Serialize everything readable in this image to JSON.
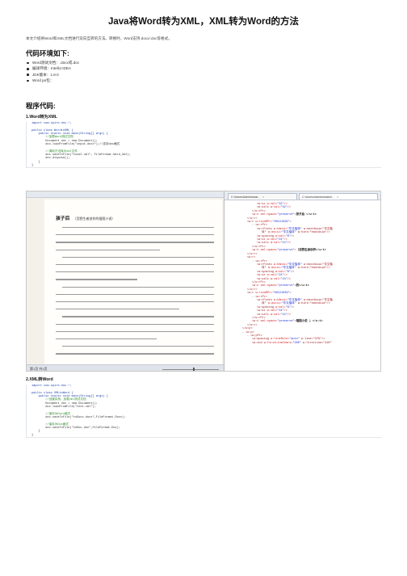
{
  "page": {
    "title": "Java将Word转为XML，XML转为Word的方法",
    "intro": "本文介绍将Word和XML文档进行双向互转的方法。转换时，Word支持.docx/.doc等格式。"
  },
  "env": {
    "heading": "代码环境如下:",
    "items": [
      "Word测试文档：.docx或.doc",
      "编译环境：IntelliJ IDEA",
      "JDK版本：1.8.0",
      "Word jar包："
    ]
  },
  "code_section": {
    "heading": "程序代码:",
    "sub1": "1.Word转为XML",
    "code1": [
      {
        "text": "import com.spire.doc.*;",
        "style": "kw"
      },
      {
        "text": "",
        "style": ""
      },
      {
        "text": "public class WordtoXML {",
        "style": "kw"
      },
      {
        "text": "    public static void main(String[] args) {",
        "style": "kw"
      },
      {
        "text": "        //加载Word测试文档",
        "style": "cm"
      },
      {
        "text": "        Document doc = new Document();",
        "style": ""
      },
      {
        "text": "        doc.loadFromFile(\"input.docx\");//支持doc格式",
        "style": ""
      },
      {
        "text": "",
        "style": ""
      },
      {
        "text": "        //调用方法转为xml文件",
        "style": "cm"
      },
      {
        "text": "        doc.saveToFile(\"toxml.xml\", FileFormat.Word_Xml);",
        "style": ""
      },
      {
        "text": "        doc.dispose();",
        "style": ""
      },
      {
        "text": "    }",
        "style": ""
      },
      {
        "text": "}",
        "style": ""
      }
    ],
    "sub2": "2.XML转Word",
    "code2": [
      {
        "text": "import com.spire.doc.*;",
        "style": "kw"
      },
      {
        "text": "",
        "style": ""
      },
      {
        "text": "public class XMLtoWord {",
        "style": "kw"
      },
      {
        "text": "    public static void main(String[] args) {",
        "style": "kw"
      },
      {
        "text": "        //创建实例，加载xml测试文档",
        "style": "cm"
      },
      {
        "text": "        Document doc = new Document();",
        "style": ""
      },
      {
        "text": "        doc.loadFromFile(\"test.xml\");",
        "style": ""
      },
      {
        "text": "",
        "style": ""
      },
      {
        "text": "        //保存为Docx格式",
        "style": "cm"
      },
      {
        "text": "        doc.saveToFile(\"toDocx.docx\",FileFormat.Docx);",
        "style": ""
      },
      {
        "text": "",
        "style": ""
      },
      {
        "text": "        //保存为Doc格式",
        "style": "cm"
      },
      {
        "text": "        doc.saveToFile(\"toDoc.doc\",FileFormat.Doc);",
        "style": ""
      },
      {
        "text": "    }",
        "style": ""
      },
      {
        "text": "}",
        "style": ""
      }
    ]
  },
  "screenshot": {
    "doc_heading": "孩子后",
    "doc_subheading": "（怎野生者创作的插图小说）",
    "status_page": "第1页 共1页",
    "tab1": "C:\\Users\\Administrat...",
    "tab2": "C:\\Users\\Administrator\\...",
    "xml_lines": [
      {
        "i": 6,
        "pre": "<w:sz ",
        "attr": "w:val=",
        "val": "\"32\"",
        "post": "/>",
        "text": ""
      },
      {
        "i": 6,
        "pre": "<w:szCs ",
        "attr": "w:val=",
        "val": "\"32\"",
        "post": "/>",
        "text": ""
      },
      {
        "i": 5,
        "pre": "</w:rPr>",
        "attr": "",
        "val": "",
        "post": "",
        "text": ""
      },
      {
        "i": 5,
        "pre": "<w:t ",
        "attr": "xml:space=",
        "val": "\"preserve\"",
        "post": ">",
        "text": "孩子后 </w:t>"
      },
      {
        "i": 4,
        "pre": "</w:r>",
        "attr": "",
        "val": "",
        "post": "",
        "text": ""
      },
      {
        "i": 4,
        "pre": "<w:r ",
        "attr": "w:rsidRPr=",
        "val": "\"00C21039\"",
        "post": ">",
        "text": ""
      },
      {
        "i": 5,
        "pre": "- <w:rPr>",
        "attr": "",
        "val": "",
        "post": "",
        "text": ""
      },
      {
        "i": 6,
        "pre": "<w:rFonts ",
        "attr": "w:hAnsi=",
        "val": "\"华文楷体\"",
        "post": " w:eastAsia=\"华文楷",
        "text": ""
      },
      {
        "i": 7,
        "pre": "体\" ",
        "attr": "w:ascii=",
        "val": "\"华文楷体\"",
        "post": " w:hint=\"eastAsia\"/>",
        "text": ""
      },
      {
        "i": 6,
        "pre": "<w:spacing ",
        "attr": "w:val=",
        "val": "\"6\"",
        "post": "/>",
        "text": ""
      },
      {
        "i": 6,
        "pre": "<w:sz ",
        "attr": "w:val=",
        "val": "\"24\"",
        "post": "/>",
        "text": ""
      },
      {
        "i": 6,
        "pre": "<w:szCs ",
        "attr": "w:val=",
        "val": "\"24\"",
        "post": "/>",
        "text": ""
      },
      {
        "i": 5,
        "pre": "</w:rPr>",
        "attr": "",
        "val": "",
        "post": "",
        "text": ""
      },
      {
        "i": 5,
        "pre": "<w:t ",
        "attr": "xml:space=",
        "val": "\"preserve\"",
        "post": ">",
        "text": "（怎野生者创作</w:t>"
      },
      {
        "i": 4,
        "pre": "</w:r>",
        "attr": "",
        "val": "",
        "post": "",
        "text": ""
      },
      {
        "i": 4,
        "pre": "<w:r>",
        "attr": "",
        "val": "",
        "post": "",
        "text": ""
      },
      {
        "i": 5,
        "pre": "- <w:rPr>",
        "attr": "",
        "val": "",
        "post": "",
        "text": ""
      },
      {
        "i": 6,
        "pre": "<w:rFonts ",
        "attr": "w:hAnsi=",
        "val": "\"华文楷体\"",
        "post": " w:eastAsia=\"华文楷",
        "text": ""
      },
      {
        "i": 7,
        "pre": "体\" ",
        "attr": "w:ascii=",
        "val": "\"华文楷体\"",
        "post": " w:hint=\"eastAsia\"/>",
        "text": ""
      },
      {
        "i": 6,
        "pre": "<w:spacing ",
        "attr": "w:val=",
        "val": "\"6\"",
        "post": "/>",
        "text": ""
      },
      {
        "i": 6,
        "pre": "<w:sz ",
        "attr": "w:val=",
        "val": "\"24\"",
        "post": "/>",
        "text": ""
      },
      {
        "i": 6,
        "pre": "<w:szCs ",
        "attr": "w:val=",
        "val": "\"24\"",
        "post": "/>",
        "text": ""
      },
      {
        "i": 5,
        "pre": "</w:rPr>",
        "attr": "",
        "val": "",
        "post": "",
        "text": ""
      },
      {
        "i": 5,
        "pre": "<w:t ",
        "attr": "xml:space=",
        "val": "\"preserve\"",
        "post": ">",
        "text": "的</w:t>"
      },
      {
        "i": 4,
        "pre": "</w:r>",
        "attr": "",
        "val": "",
        "post": "",
        "text": ""
      },
      {
        "i": 4,
        "pre": "<w:r ",
        "attr": "w:rsidRPr=",
        "val": "\"00C21039\"",
        "post": ">",
        "text": ""
      },
      {
        "i": 5,
        "pre": "- <w:rPr>",
        "attr": "",
        "val": "",
        "post": "",
        "text": ""
      },
      {
        "i": 6,
        "pre": "<w:rFonts ",
        "attr": "w:hAnsi=",
        "val": "\"华文楷体\"",
        "post": " w:eastAsia=\"华文楷",
        "text": ""
      },
      {
        "i": 7,
        "pre": "体\" ",
        "attr": "w:ascii=",
        "val": "\"华文楷体\"",
        "post": " w:hint=\"eastAsia\"/>",
        "text": ""
      },
      {
        "i": 6,
        "pre": "<w:spacing ",
        "attr": "w:val=",
        "val": "\"6\"",
        "post": "/>",
        "text": ""
      },
      {
        "i": 6,
        "pre": "<w:sz ",
        "attr": "w:val=",
        "val": "\"24\"",
        "post": "/>",
        "text": ""
      },
      {
        "i": 6,
        "pre": "<w:szCs ",
        "attr": "w:val=",
        "val": "\"24\"",
        "post": "/>",
        "text": ""
      },
      {
        "i": 5,
        "pre": "</w:rPr>",
        "attr": "",
        "val": "",
        "post": "",
        "text": ""
      },
      {
        "i": 5,
        "pre": "<w:t ",
        "attr": "xml:space=",
        "val": "\"preserve\"",
        "post": ">",
        "text": "插图小说 ) </w:t>"
      },
      {
        "i": 4,
        "pre": "</w:r>",
        "attr": "",
        "val": "",
        "post": "",
        "text": ""
      },
      {
        "i": 3,
        "pre": "</w:p>",
        "attr": "",
        "val": "",
        "post": "",
        "text": ""
      },
      {
        "i": 3,
        "pre": "- <w:p>",
        "attr": "",
        "val": "",
        "post": "",
        "text": ""
      },
      {
        "i": 4,
        "pre": "- <w:pPr>",
        "attr": "",
        "val": "",
        "post": "",
        "text": ""
      },
      {
        "i": 5,
        "pre": "<w:spacing ",
        "attr": "w:lineRule=",
        "val": "\"auto\"",
        "post": " w:line=\"376\"/>",
        "text": ""
      },
      {
        "i": 5,
        "pre": "<w:ind ",
        "attr": "w:firstLineChars=",
        "val": "\"200\"",
        "post": " w:firstLine=\"420\"",
        "text": ""
      }
    ]
  }
}
